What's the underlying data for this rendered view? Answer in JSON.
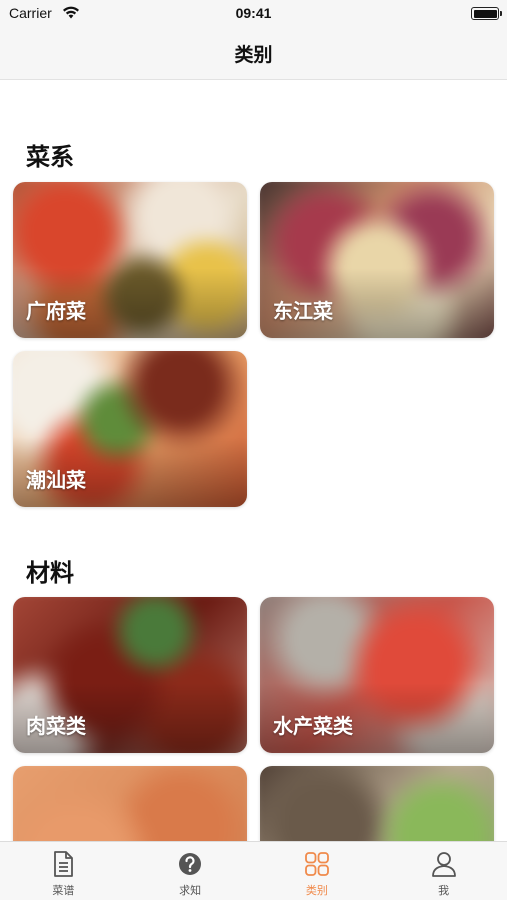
{
  "status_bar": {
    "carrier": "Carrier",
    "time": "09:41"
  },
  "nav": {
    "title": "类别"
  },
  "sections": [
    {
      "title": "菜系",
      "cards": [
        "广府菜",
        "东江菜",
        "潮汕菜"
      ]
    },
    {
      "title": "材料",
      "cards": [
        "肉菜类",
        "水产菜类",
        "",
        ""
      ]
    }
  ],
  "tab_bar": {
    "items": [
      {
        "label": "菜谱",
        "icon": "document-icon",
        "active": false
      },
      {
        "label": "求知",
        "icon": "question-icon",
        "active": false
      },
      {
        "label": "类别",
        "icon": "grid-icon",
        "active": true
      },
      {
        "label": "我",
        "icon": "person-icon",
        "active": false
      }
    ],
    "active_color": "#f08a4b",
    "inactive_color": "#555555"
  }
}
